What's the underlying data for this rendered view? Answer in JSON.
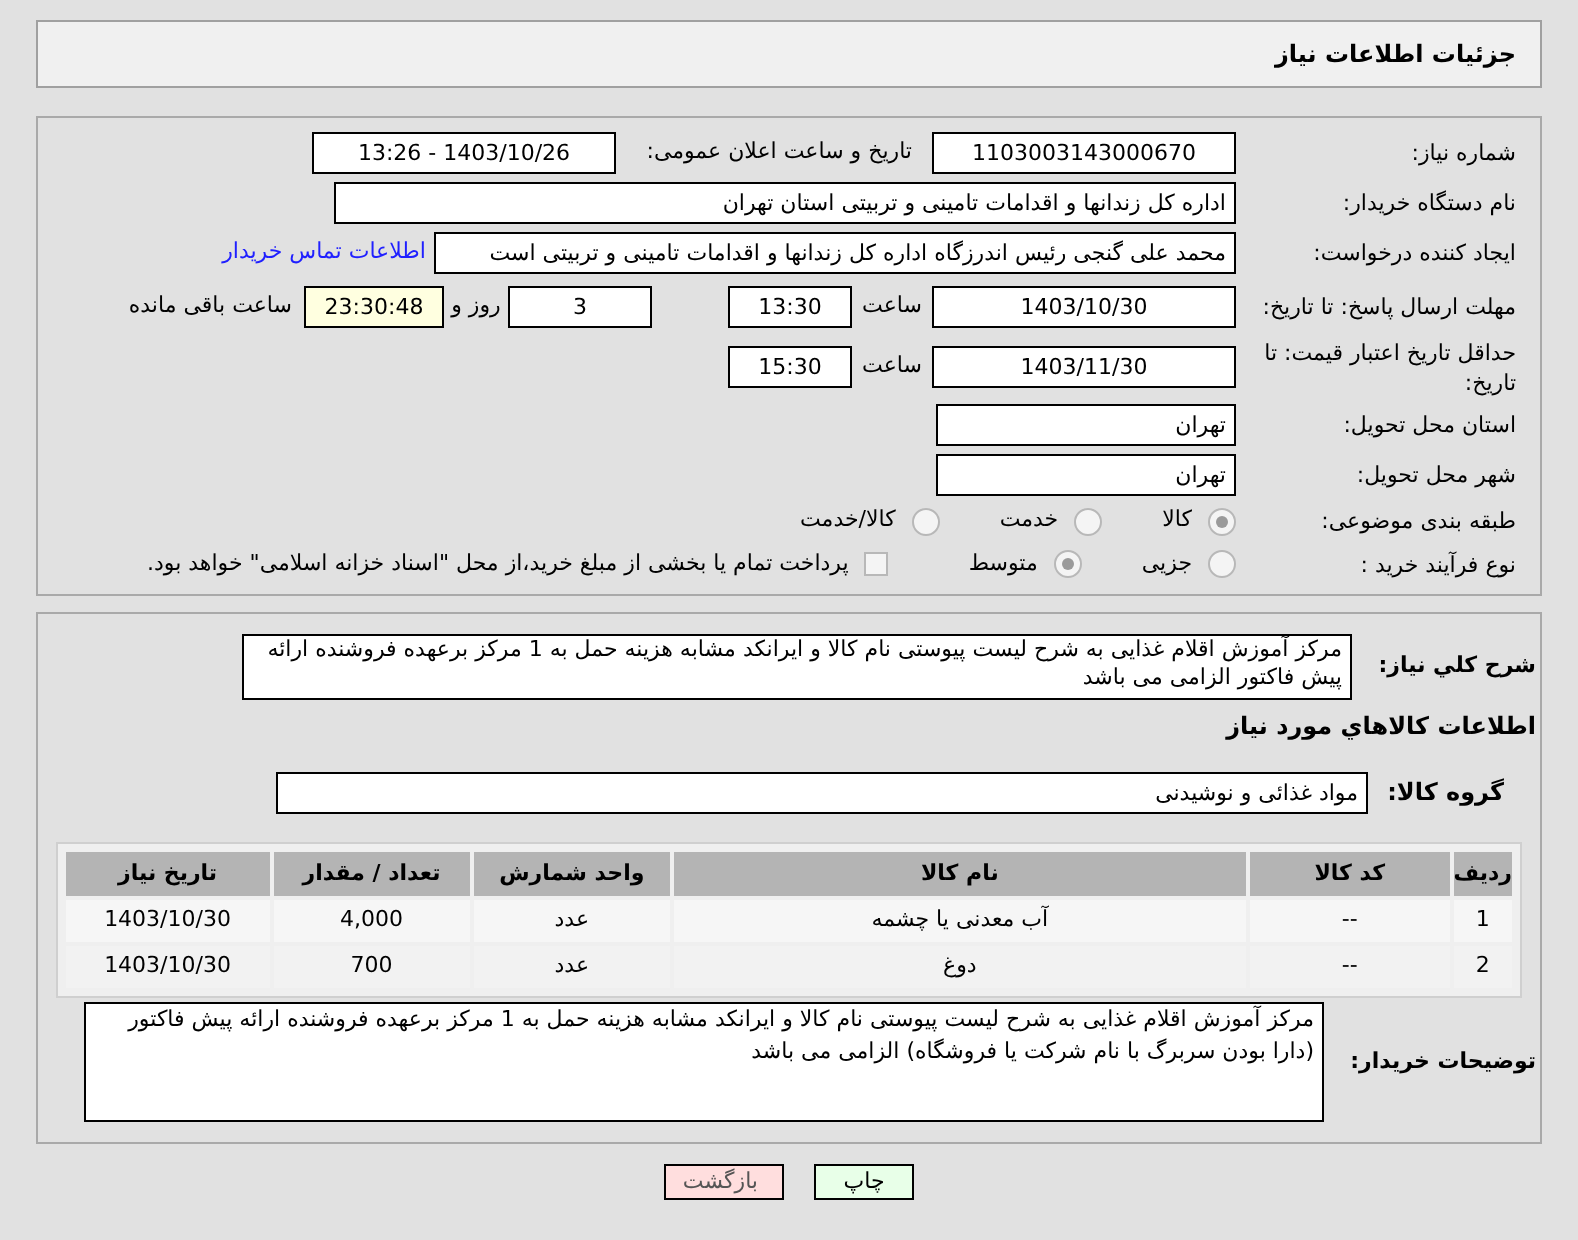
{
  "page_title": "جزئیات اطلاعات نیاز",
  "need_number": {
    "label": "شماره نیاز:",
    "value": "1103003143000670"
  },
  "announce": {
    "label": "تاریخ و ساعت اعلان عمومی:",
    "value": "1403/10/26 - 13:26"
  },
  "buyer_org": {
    "label": "نام دستگاه خریدار:",
    "value": "اداره کل زندانها و اقدامات تامینی و تربیتی استان تهران"
  },
  "requester": {
    "label": "ایجاد کننده درخواست:",
    "value": "محمد علی گنجی رئیس اندرزگاه  اداره کل زندانها و اقدامات تامینی و تربیتی است",
    "link": "اطلاعات تماس خریدار"
  },
  "reply_deadline": {
    "label": "مهلت ارسال پاسخ: تا تاریخ:",
    "date": "1403/10/30",
    "time_label": "ساعت",
    "time": "13:30",
    "days": "3",
    "days_label": "روز و",
    "remaining": "23:30:48",
    "remaining_label": "ساعت باقی مانده"
  },
  "price_validity": {
    "label": "حداقل تاریخ اعتبار قیمت: تا تاریخ:",
    "date": "1403/11/30",
    "time_label": "ساعت",
    "time": "15:30"
  },
  "province": {
    "label": "استان محل تحویل:",
    "value": "تهران"
  },
  "city": {
    "label": "شهر محل تحویل:",
    "value": "تهران"
  },
  "category": {
    "label": "طبقه بندی موضوعی:",
    "options": [
      {
        "label": "کالا",
        "selected": true
      },
      {
        "label": "خدمت",
        "selected": false
      },
      {
        "label": "کالا/خدمت",
        "selected": false
      }
    ]
  },
  "process": {
    "label": "نوع فرآیند خرید :",
    "options": [
      {
        "label": "جزیی",
        "selected": false
      },
      {
        "label": "متوسط",
        "selected": true
      }
    ],
    "treasury": {
      "checked": false,
      "label": "پرداخت تمام یا بخشی از مبلغ خرید،از محل \"اسناد خزانه اسلامی\" خواهد بود."
    }
  },
  "description": {
    "label": "شرح کلي نياز:",
    "value": "مرکز آموزش اقلام غذایی به شرح لیست پیوستی نام کالا و ایرانکد مشابه هزینه حمل به 1 مرکز برعهده فروشنده ارائه پیش فاکتور الزامی می باشد"
  },
  "goods_heading": "اطلاعات کالاهاي مورد نياز",
  "goods_group": {
    "label": "گروه کالا:",
    "value": "مواد غذائی و نوشیدنی"
  },
  "table": {
    "columns": [
      "ردیف",
      "کد کالا",
      "نام کالا",
      "واحد شمارش",
      "تعداد / مقدار",
      "تاریخ نیاز"
    ],
    "rows": [
      [
        "1",
        "--",
        "آب معدنی یا چشمه",
        "عدد",
        "4,000",
        "1403/10/30"
      ],
      [
        "2",
        "--",
        "دوغ",
        "عدد",
        "700",
        "1403/10/30"
      ]
    ]
  },
  "buyer_notes": {
    "label": "توضیحات خریدار:",
    "value": "مرکز آموزش اقلام غذایی به شرح لیست پیوستی نام کالا و ایرانکد مشابه هزینه حمل به 1 مرکز برعهده فروشنده ارائه پیش فاکتور (دارا بودن سربرگ با نام شرکت یا فروشگاه) الزامی می باشد"
  },
  "buttons": [
    {
      "kind": "print",
      "label": "چاپ"
    },
    {
      "kind": "back",
      "label": "بازگشت"
    }
  ]
}
